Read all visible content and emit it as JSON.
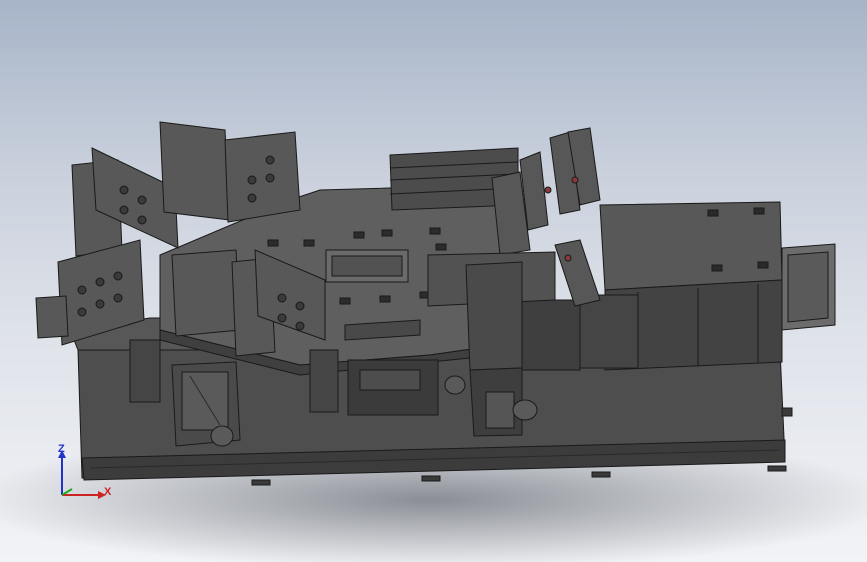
{
  "viewport": {
    "background_top": "#a7b4c8",
    "background_bottom": "#f2f3f6",
    "model_color": "#4a4a4a"
  },
  "triad": {
    "z_label": "Z",
    "x_label": "X",
    "z_color": "#2233cc",
    "x_color": "#cc2222",
    "y_color": "#22aa22"
  }
}
